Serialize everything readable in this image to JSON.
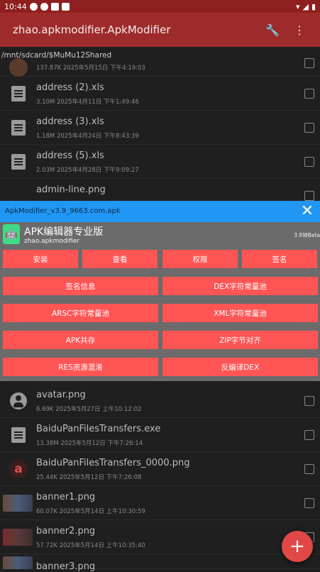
{
  "status_bar": {
    "time": "10:44"
  },
  "app_bar": {
    "title": "zhao.apkmodifier.ApkModifier",
    "wrench_icon": "wrench-icon",
    "more_icon": "more-vert-icon"
  },
  "path": "/mnt/sdcard/$MuMu12Shared",
  "files_top": [
    {
      "name": "",
      "meta": "137.87K   2025年5月15日 下午4:19:03",
      "icon": "app-icon"
    },
    {
      "name": "address (2).xls",
      "meta": "3.10M   2025年4月11日 下午1:49:46",
      "icon": "document-icon"
    },
    {
      "name": "address (3).xls",
      "meta": "1.18M   2025年4月24日 下午8:43:39",
      "icon": "document-icon"
    },
    {
      "name": "address (5).xls",
      "meta": "2.03M   2025年4月28日 下午9:09:27",
      "icon": "document-icon"
    },
    {
      "name": "admin-line.png",
      "meta": "",
      "icon": "person-icon"
    }
  ],
  "dialog": {
    "filename": "ApkModifier_v3.9_9663.com.apk",
    "app_name": "APK编辑器专业版",
    "package": "zhao.apkmodifier",
    "version": "3.9钟Beta",
    "buttons_row1": [
      "安装",
      "查看",
      "权限",
      "签名"
    ],
    "buttons_pairs": [
      [
        "签名信息",
        "DEX字符常量池"
      ],
      [
        "ARSC字符常量池",
        "XML字符常量池"
      ],
      [
        "APK共存",
        "ZIP字节对齐"
      ],
      [
        "RES资源混淆",
        "反编译DEX"
      ]
    ]
  },
  "files_bottom": [
    {
      "name": "avatar.png",
      "meta": "6.69K   2025年5月27日 上午10:12:02",
      "icon": "person-icon"
    },
    {
      "name": "BaiduPanFilesTransfers.exe",
      "meta": "13.38M   2025年5月12日 下午7:26:14",
      "icon": "document-icon"
    },
    {
      "name": "BaiduPanFilesTransfers_0000.png",
      "meta": "25.44K   2025年5月12日 下午7:26:08",
      "icon": "a-logo-icon"
    },
    {
      "name": "banner1.png",
      "meta": "60.07K   2025年5月14日 上午10:30:59",
      "icon": "image-thumbnail"
    },
    {
      "name": "banner2.png",
      "meta": "57.72K   2025年5月14日 上午10:35:40",
      "icon": "image-thumbnail"
    },
    {
      "name": "banner3.png",
      "meta": "",
      "icon": "image-thumbnail"
    }
  ],
  "fab": {
    "label": "+"
  }
}
